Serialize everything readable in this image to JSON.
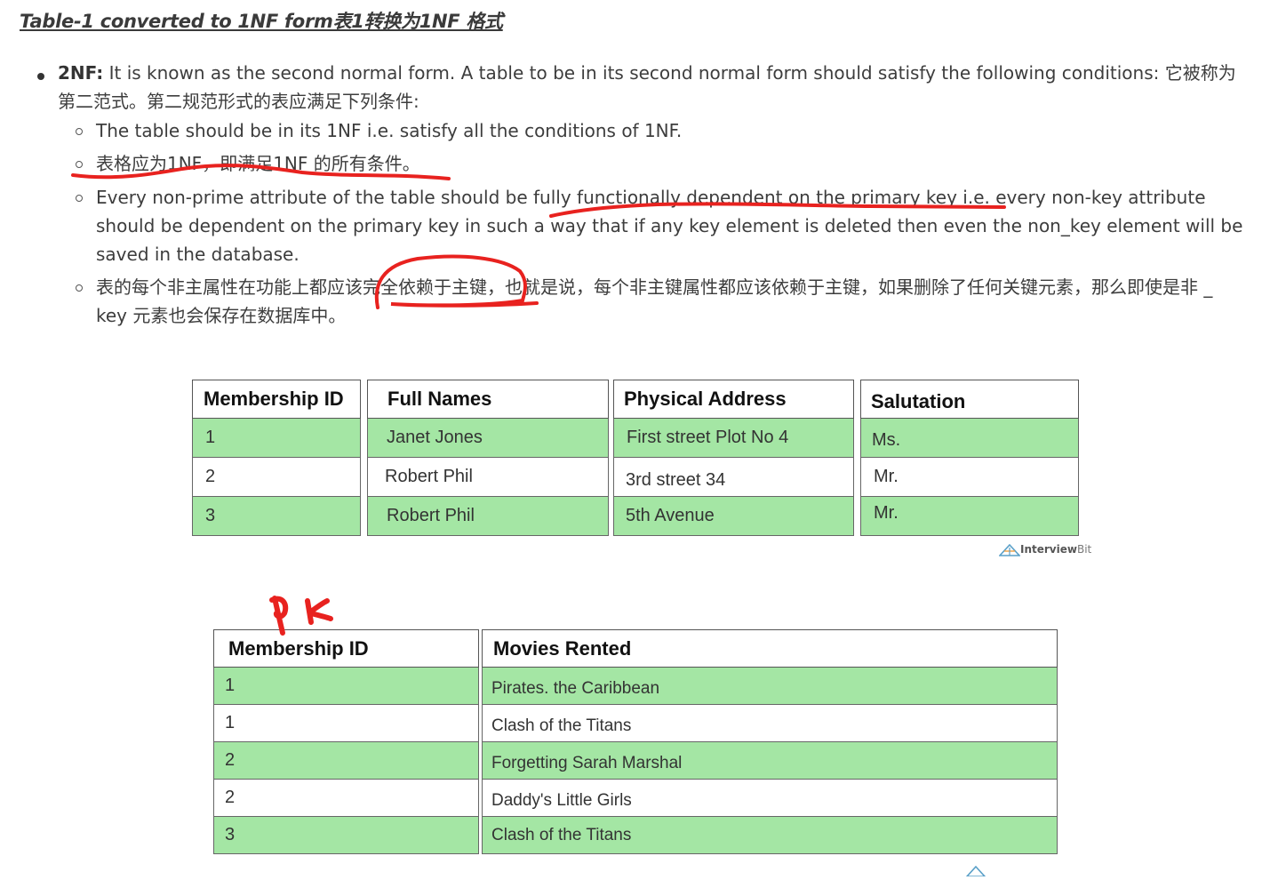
{
  "heading": "Table-1 converted to 1NF form表1转换为1NF 格式",
  "nf2": {
    "term": "2NF:",
    "text": " It is known as the second normal form. A table to be in its second normal form should satisfy the following conditions:  它被称为第二范式。第二规范形式的表应满足下列条件:",
    "items": [
      "The table should be in its 1NF i.e. satisfy all the conditions of 1NF.",
      "表格应为1NF，即满足1NF 的所有条件。",
      "Every non-prime attribute of the table should be fully functionally dependent on the primary key i.e. every non-key attribute should be dependent on the primary key in such a way that if any key element is deleted then even the non_key element will be saved in the database.",
      "表的每个非主属性在功能上都应该完全依赖于主键，也就是说，每个非主键属性都应该依赖于主键，如果删除了任何关键元素，那么即使是非 _ key 元素也会保存在数据库中。"
    ]
  },
  "table1": {
    "columns": [
      {
        "header": "Membership ID",
        "cells": [
          "1",
          "2",
          "3"
        ]
      },
      {
        "header": "Full Names",
        "cells": [
          "Janet Jones",
          "Robert Phil",
          "Robert Phil"
        ]
      },
      {
        "header": "Physical Address",
        "cells": [
          "First street Plot No 4",
          "3rd street 34",
          "5th Avenue"
        ]
      },
      {
        "header": "Salutation",
        "cells": [
          "Ms.",
          "Mr.",
          "Mr."
        ]
      }
    ],
    "logo": {
      "brand": "Interview",
      "suffix": "Bit"
    }
  },
  "annotation": "PK",
  "table2": {
    "columns": [
      {
        "header": "Membership ID",
        "cells": [
          "1",
          "1",
          "2",
          "2",
          "3"
        ]
      },
      {
        "header": "Movies Rented",
        "cells": [
          "Pirates. the Caribbean",
          "Clash of the Titans",
          "Forgetting Sarah Marshal",
          "Daddy's Little Girls",
          "Clash of the Titans"
        ]
      }
    ]
  },
  "colors": {
    "row_green": "#a4e6a4",
    "annotation_red": "#e8221f",
    "text": "#3d3d3d"
  }
}
